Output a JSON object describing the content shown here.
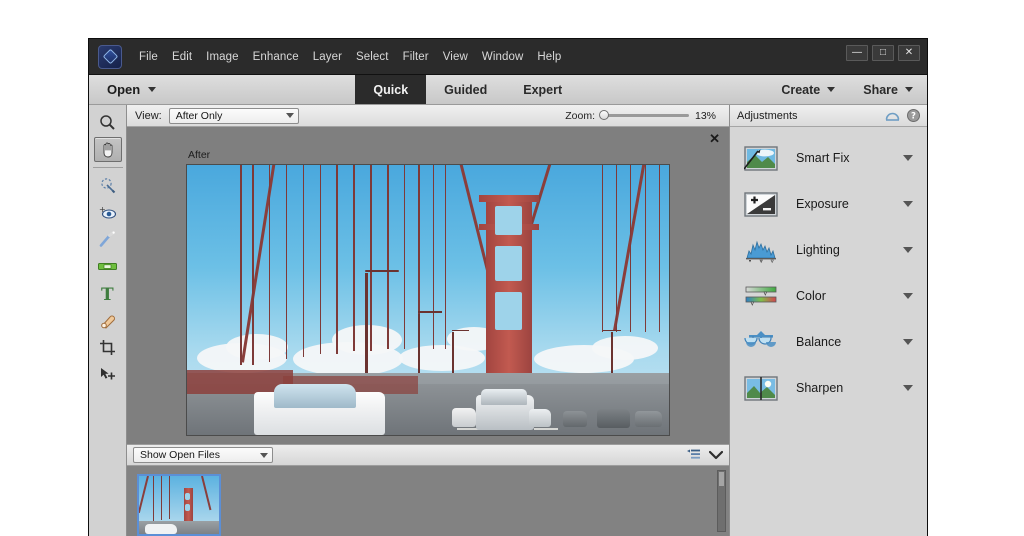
{
  "window": {
    "controls": {
      "minimize": "—",
      "maximize": "□",
      "close": "✕"
    }
  },
  "menubar": {
    "logo": "app-logo-icon",
    "items": [
      "File",
      "Edit",
      "Image",
      "Enhance",
      "Layer",
      "Select",
      "Filter",
      "View",
      "Window",
      "Help"
    ]
  },
  "modebar": {
    "open_label": "Open",
    "tabs": [
      {
        "label": "Quick",
        "active": true
      },
      {
        "label": "Guided",
        "active": false
      },
      {
        "label": "Expert",
        "active": false
      }
    ],
    "actions": [
      {
        "label": "Create"
      },
      {
        "label": "Share"
      }
    ]
  },
  "toolbox": {
    "tools": [
      {
        "name": "zoom-tool",
        "title": "Zoom",
        "active": false
      },
      {
        "name": "hand-tool",
        "title": "Hand",
        "active": true
      },
      {
        "name": "quick-selection-tool",
        "title": "Quick Selection",
        "active": false
      },
      {
        "name": "red-eye-removal-tool",
        "title": "Red Eye Removal",
        "active": false
      },
      {
        "name": "whiten-teeth-tool",
        "title": "Whiten Teeth",
        "active": false
      },
      {
        "name": "straighten-tool",
        "title": "Straighten",
        "active": false
      },
      {
        "name": "type-tool",
        "title": "Type",
        "active": false
      },
      {
        "name": "spot-healing-brush-tool",
        "title": "Spot Healing Brush",
        "active": false
      },
      {
        "name": "crop-tool",
        "title": "Crop",
        "active": false
      },
      {
        "name": "move-tool",
        "title": "Move",
        "active": false
      }
    ]
  },
  "optionbar": {
    "view_label": "View:",
    "view_value": "After Only",
    "zoom_label": "Zoom:",
    "zoom_value": "13%",
    "zoom_slider_percent": 0
  },
  "canvas": {
    "close_glyph": "✕",
    "image_label": "After",
    "image_subject": "golden-gate-bridge-photo"
  },
  "binbar": {
    "filter_value": "Show Open Files",
    "sort_icon": "sort-list-icon",
    "collapse_icon": "chevron-down-icon"
  },
  "photobin": {
    "thumbnails": [
      {
        "name": "thumbnail-golden-gate",
        "selected": true
      }
    ]
  },
  "adjustments": {
    "panel_title": "Adjustments",
    "header_icons": [
      {
        "name": "reset-adjustments-icon"
      },
      {
        "name": "help-icon"
      }
    ],
    "items": [
      {
        "label": "Smart Fix",
        "icon": "smart-fix-icon"
      },
      {
        "label": "Exposure",
        "icon": "exposure-icon"
      },
      {
        "label": "Lighting",
        "icon": "lighting-histogram-icon"
      },
      {
        "label": "Color",
        "icon": "color-sliders-icon"
      },
      {
        "label": "Balance",
        "icon": "balance-scales-icon"
      },
      {
        "label": "Sharpen",
        "icon": "sharpen-icon"
      }
    ]
  },
  "colors": {
    "menubar_bg": "#2b2b2b",
    "panel_bg": "#d6d6d6",
    "canvas_bg": "#7f7f7f",
    "active_tab_bg": "#2b2b2b",
    "selection_blue": "#5b8fd6",
    "bridge_red": "#a24540"
  }
}
